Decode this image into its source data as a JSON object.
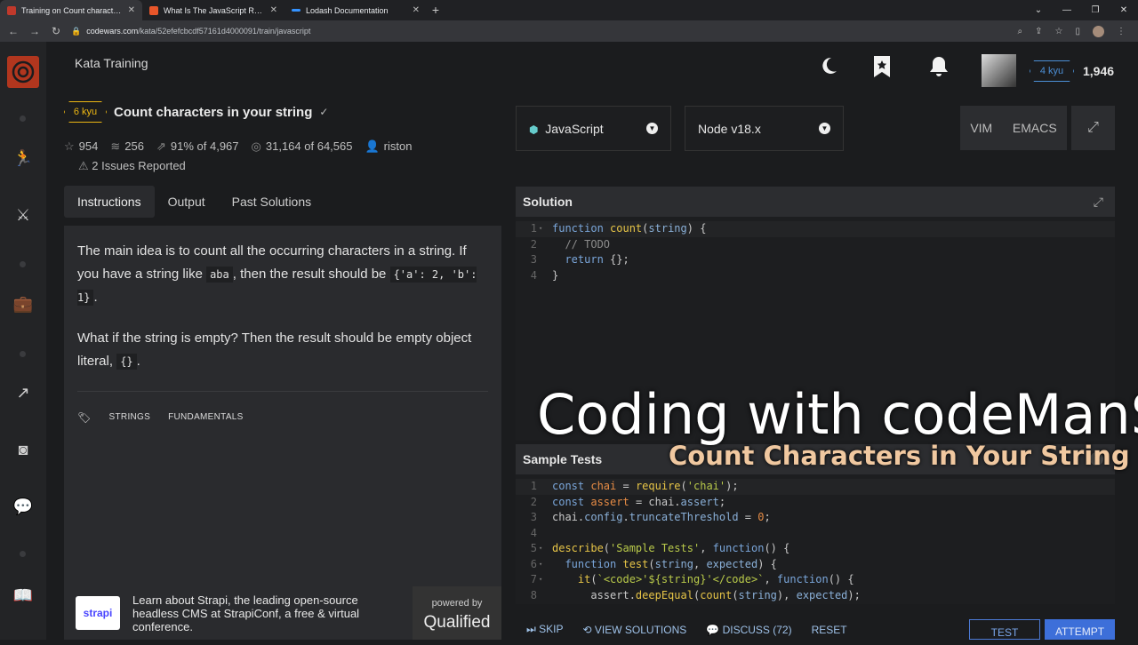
{
  "browser": {
    "tabs": [
      {
        "title": "Training on Count characters in y",
        "color": "#c0392b"
      },
      {
        "title": "What Is The JavaScript Require F",
        "color": "#e8562a"
      },
      {
        "title": "Lodash Documentation",
        "color": "#3492ff"
      }
    ],
    "url_host": "codewars.com",
    "url_path": "/kata/52efefcbcdf57161d4000091/train/javascript"
  },
  "header": {
    "title": "Kata Training",
    "rank": "4 kyu",
    "honor": "1,946"
  },
  "kata": {
    "rank": "6 kyu",
    "name": "Count characters in your string",
    "stats": {
      "stars": "954",
      "collections": "256",
      "satisfaction": "91%",
      "satisfaction_of": "of 4,967",
      "completed": "31,164",
      "completed_of": "of 64,565",
      "author": "riston"
    },
    "issues": "2 Issues Reported"
  },
  "tabs": [
    "Instructions",
    "Output",
    "Past Solutions"
  ],
  "instructions": {
    "p1_a": "The main idea is to count all the occurring characters in a string. If you have a string like ",
    "p1_code1": "aba",
    "p1_b": ", then the result should be ",
    "p1_code2": "{'a': 2, 'b': 1}",
    "p1_c": ".",
    "p2_a": "What if the string is empty? Then the result should be empty object literal, ",
    "p2_code": "{}",
    "p2_b": "."
  },
  "tags": [
    "STRINGS",
    "FUNDAMENTALS"
  ],
  "ad": {
    "logo": "strapi",
    "text": "Learn about Strapi, the leading open-source headless CMS at StrapiConf, a free & virtual conference.",
    "powered_by": "powered by",
    "brand": "Qualified"
  },
  "editor_controls": {
    "language": "JavaScript",
    "version": "Node v18.x",
    "mode_vim": "VIM",
    "mode_emacs": "EMACS"
  },
  "solution": {
    "label": "Solution"
  },
  "sample_tests": {
    "label": "Sample Tests"
  },
  "overlay": {
    "title": "Coding with codeManS",
    "subtitle": "Count Characters in Your String"
  },
  "bottom_bar": {
    "skip": "SKIP",
    "view_solutions": "VIEW SOLUTIONS",
    "discuss": "DISCUSS (72)",
    "reset": "RESET",
    "test": "TEST",
    "attempt": "ATTEMPT"
  }
}
